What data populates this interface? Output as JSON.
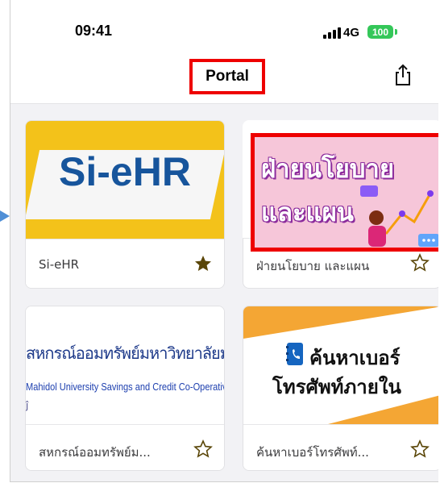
{
  "status_bar": {
    "time": "09:41",
    "network": "4G",
    "battery": "100"
  },
  "navbar": {
    "title": "Portal",
    "share_icon": "share-icon"
  },
  "cards": [
    {
      "label": "Si-eHR",
      "thumb_text": "Si-eHR",
      "favorite": true
    },
    {
      "label": "ฝ่ายนโยบาย และแผน",
      "thumb_line1": "ฝ่ายนโยบาย",
      "thumb_line2": "และแผน",
      "favorite": false
    },
    {
      "label": "สหกรณ์ออมทรัพย์ม...",
      "thumb_line1": "สหกรณ์ออมทรัพย์มหาวิทยาลัยมหิดล จำกัด",
      "thumb_line2": "Mahidol University Savings and Credit Co-Operativ",
      "favorite": false
    },
    {
      "label": "ค้นหาเบอร์โทรศัพท์...",
      "thumb_line1": "ค้นหาเบอร์",
      "thumb_line2": "โทรศัพท์ภายใน",
      "favorite": false
    }
  ],
  "colors": {
    "highlight": "#ee0000",
    "sieh_yellow": "#f3c21a",
    "sieh_blue": "#17559c",
    "policy_pink": "#f6c6d9",
    "star_filled": "#5a4608",
    "battery_green": "#34c759"
  }
}
